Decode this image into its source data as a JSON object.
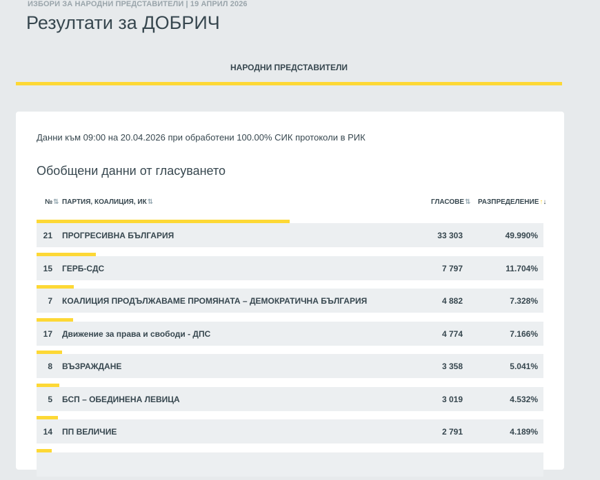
{
  "header": {
    "subtitle": "ИЗБОРИ ЗА НАРОДНИ ПРЕДСТАВИТЕЛИ | 19 АПРИЛ 2026",
    "title": "Резултати за ДОБРИЧ"
  },
  "tabs": [
    {
      "label": "НАРОДНИ ПРЕДСТАВИТЕЛИ",
      "active": true
    }
  ],
  "accent_color": "#fdd835",
  "card": {
    "info": "Данни към 09:00 на 20.04.2026 при обработени 100.00% СИК протоколи в РИК",
    "section_title": "Обобщени данни от гласуването",
    "columns": {
      "num": "№",
      "party": "ПАРТИЯ, КОАЛИЦИЯ, ИК",
      "votes": "ГЛАСОВЕ",
      "distribution": "РАЗПРЕДЕЛЕНИЕ"
    },
    "rows": [
      {
        "num": "21",
        "party": "ПРОГРЕСИВНА БЪЛГАРИЯ",
        "votes": "33 303",
        "pct": "49.990%",
        "share": 0.4999
      },
      {
        "num": "15",
        "party": "ГЕРБ-СДС",
        "votes": "7 797",
        "pct": "11.704%",
        "share": 0.11704
      },
      {
        "num": "7",
        "party": "КОАЛИЦИЯ ПРОДЪЛЖАВАМЕ ПРОМЯНАТА – ДЕМОКРАТИЧНА БЪЛГАРИЯ",
        "votes": "4 882",
        "pct": "7.328%",
        "share": 0.07328
      },
      {
        "num": "17",
        "party": "Движение за права и свободи - ДПС",
        "votes": "4 774",
        "pct": "7.166%",
        "share": 0.07166
      },
      {
        "num": "8",
        "party": "ВЪЗРАЖДАНЕ",
        "votes": "3 358",
        "pct": "5.041%",
        "share": 0.05041
      },
      {
        "num": "5",
        "party": "БСП – ОБЕДИНЕНА ЛЕВИЦА",
        "votes": "3 019",
        "pct": "4.532%",
        "share": 0.04532
      },
      {
        "num": "14",
        "party": "ПП ВЕЛИЧИЕ",
        "votes": "2 791",
        "pct": "4.189%",
        "share": 0.04189
      },
      {
        "num": "",
        "party": "",
        "votes": "",
        "pct": "",
        "share": 0.03
      }
    ]
  }
}
